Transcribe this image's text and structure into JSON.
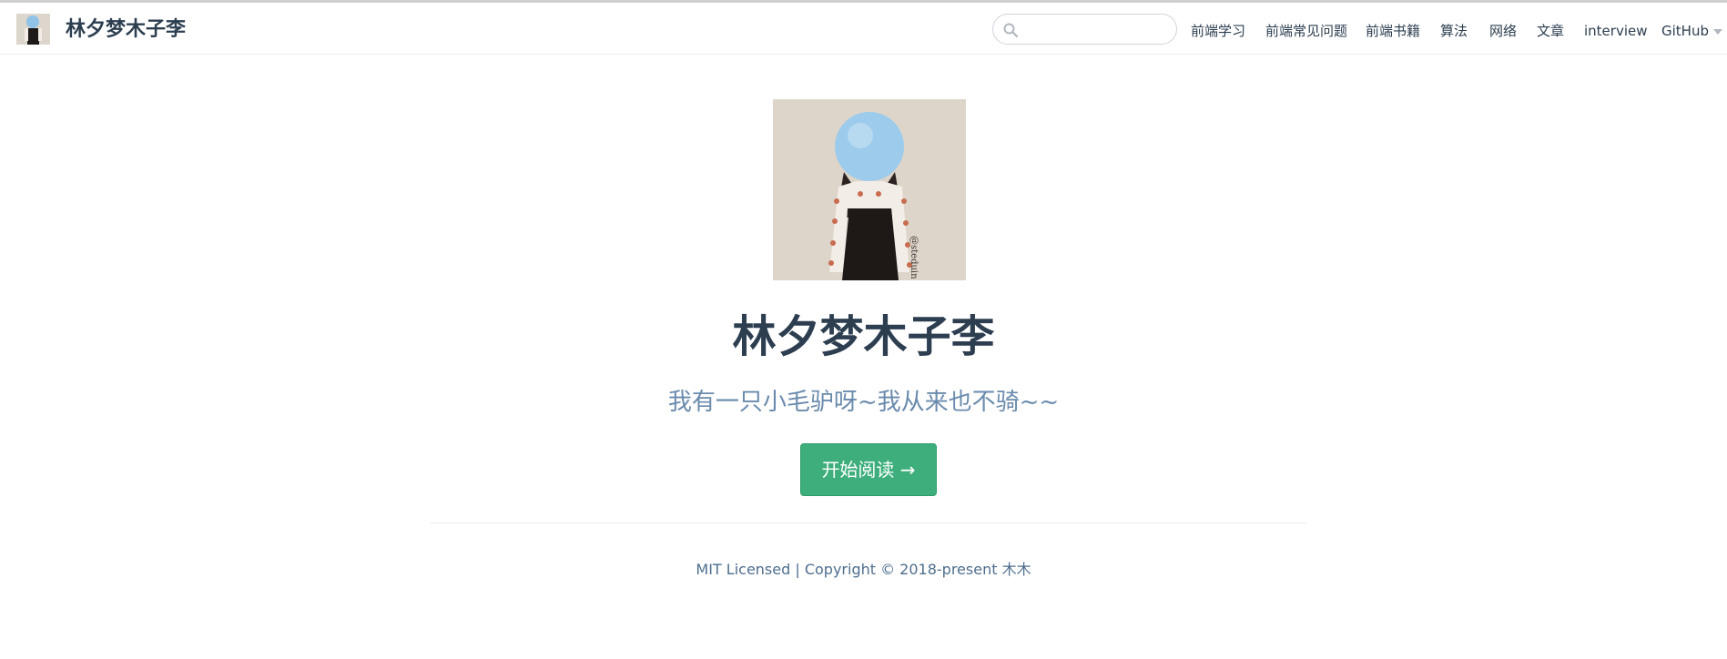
{
  "navbar": {
    "site_name": "林夕梦木子李",
    "search": {
      "value": "",
      "placeholder": ""
    },
    "links": [
      {
        "label": "前端学习"
      },
      {
        "label": "前端常见问题"
      },
      {
        "label": "前端书籍"
      },
      {
        "label": "算法"
      },
      {
        "label": "网络"
      },
      {
        "label": "文章"
      },
      {
        "label": "interview"
      },
      {
        "label": "GitHub"
      }
    ]
  },
  "hero": {
    "title": "林夕梦木子李",
    "description": "我有一只小毛驴呀~我从来也不骑~~",
    "action_label": "开始阅读 →"
  },
  "footer": {
    "text": "MIT Licensed | Copyright © 2018-present 木木"
  },
  "colors": {
    "accent": "#3eaf7c",
    "text": "#2c3e50",
    "description": "#6a8bad"
  }
}
